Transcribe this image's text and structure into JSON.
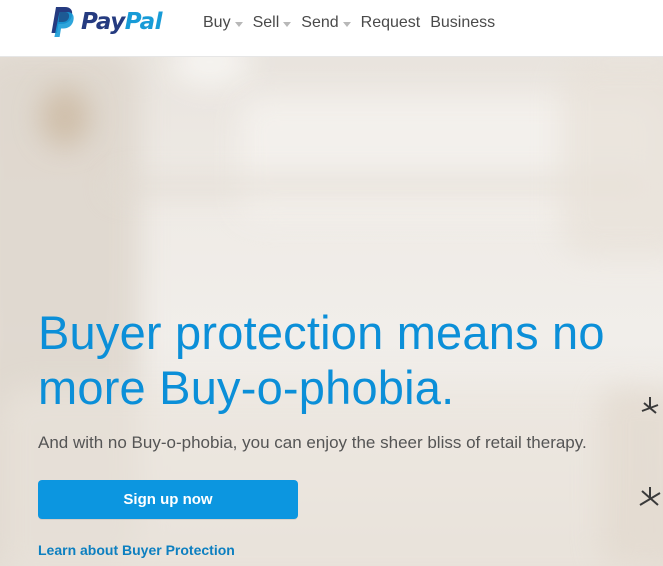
{
  "header": {
    "logo": {
      "wordmark_pay": "Pay",
      "wordmark_pal": "Pal",
      "icon": "paypal-p-icon"
    },
    "nav": [
      {
        "label": "Buy",
        "has_dropdown": true,
        "icon": "caret-down-icon"
      },
      {
        "label": "Sell",
        "has_dropdown": true,
        "icon": "caret-down-icon"
      },
      {
        "label": "Send",
        "has_dropdown": true,
        "icon": "caret-down-icon"
      },
      {
        "label": "Request",
        "has_dropdown": false
      },
      {
        "label": "Business",
        "has_dropdown": false
      }
    ]
  },
  "hero": {
    "headline": "Buyer protection means no more Buy-o-phobia.",
    "subheadline": "And with no Buy-o-phobia, you can enjoy the sheer bliss of retail therapy.",
    "cta_label": "Sign up now",
    "link_label": "Learn about Buyer Protection"
  },
  "colors": {
    "brand_dark_blue": "#253b80",
    "brand_light_blue": "#179bd7",
    "headline_blue": "#0b8fd8",
    "button_blue": "#0c96e0",
    "link_blue": "#0c7fc0",
    "body_text": "#555555",
    "nav_text": "#4a4a4a"
  }
}
